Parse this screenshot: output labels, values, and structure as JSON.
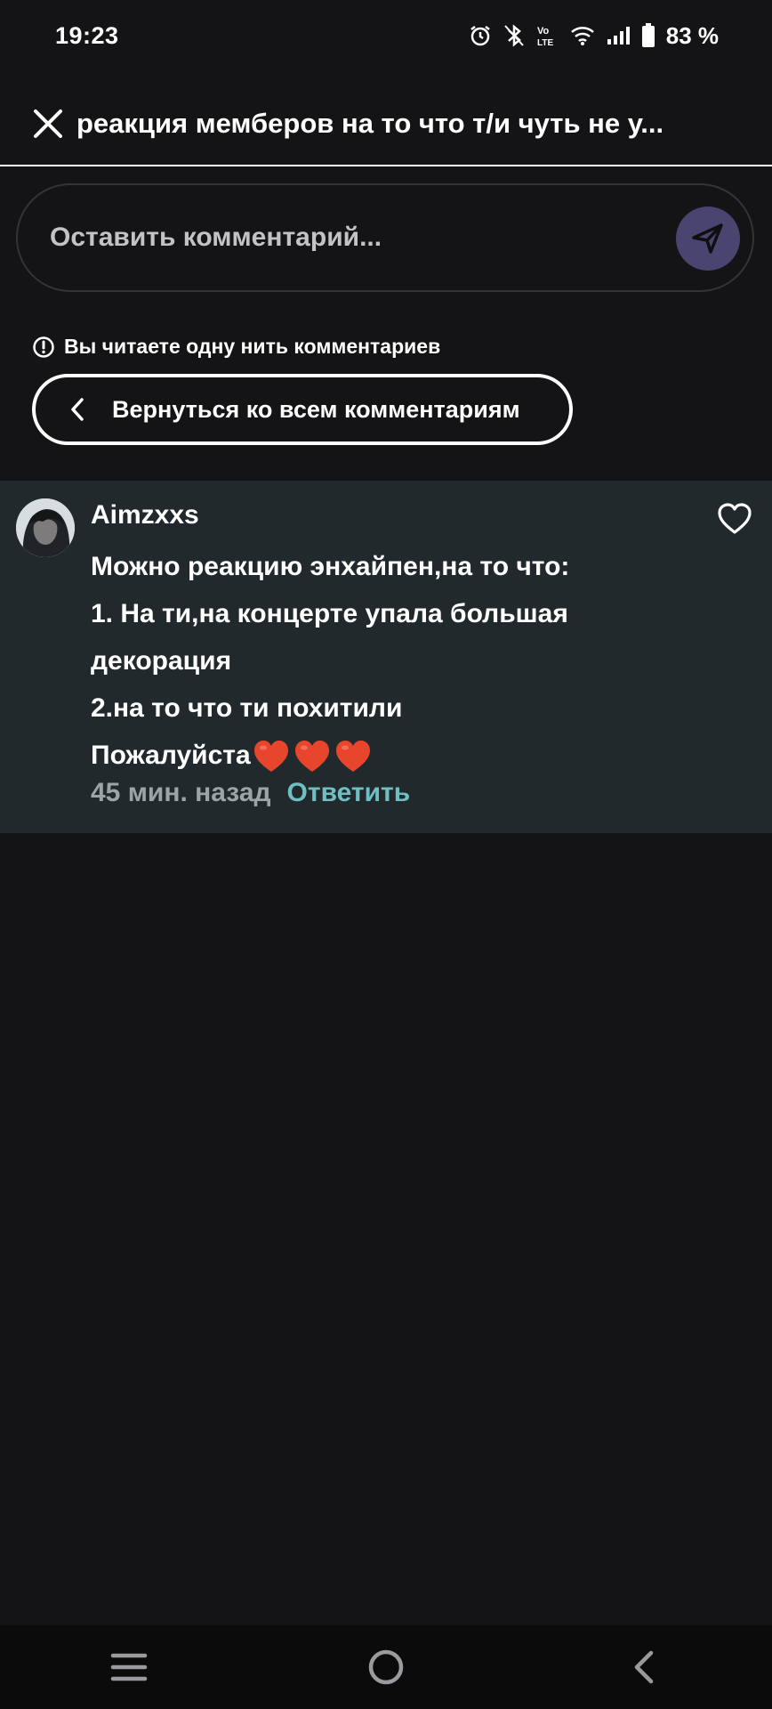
{
  "status_bar": {
    "time": "19:23",
    "battery": "83 %",
    "icons": [
      "alarm-icon",
      "bluetooth-icon",
      "volte-icon",
      "wifi-icon",
      "signal-icon",
      "battery-icon"
    ]
  },
  "header": {
    "title": "реакция мемберов на то что т/и чуть не у..."
  },
  "comment_input": {
    "placeholder": "Оставить комментарий..."
  },
  "thread": {
    "notice": "Вы читаете одну нить комментариев",
    "back_label": "Вернуться ко всем комментариям"
  },
  "comment": {
    "author": "Aimzxxs",
    "lines": [
      "Можно реакцию энхайпен,на то что:",
      "1. На ти,на концерте упала большая",
      "декорация",
      "2.на то что ти похитили",
      "Пожалуйста"
    ],
    "time_ago": "45 мин. назад",
    "reply_label": "Ответить"
  },
  "colors": {
    "background": "#141316",
    "card": "#21292c",
    "accent": "#6fbfc2",
    "send_button": "#4a4570",
    "heart": "#e8452d"
  }
}
